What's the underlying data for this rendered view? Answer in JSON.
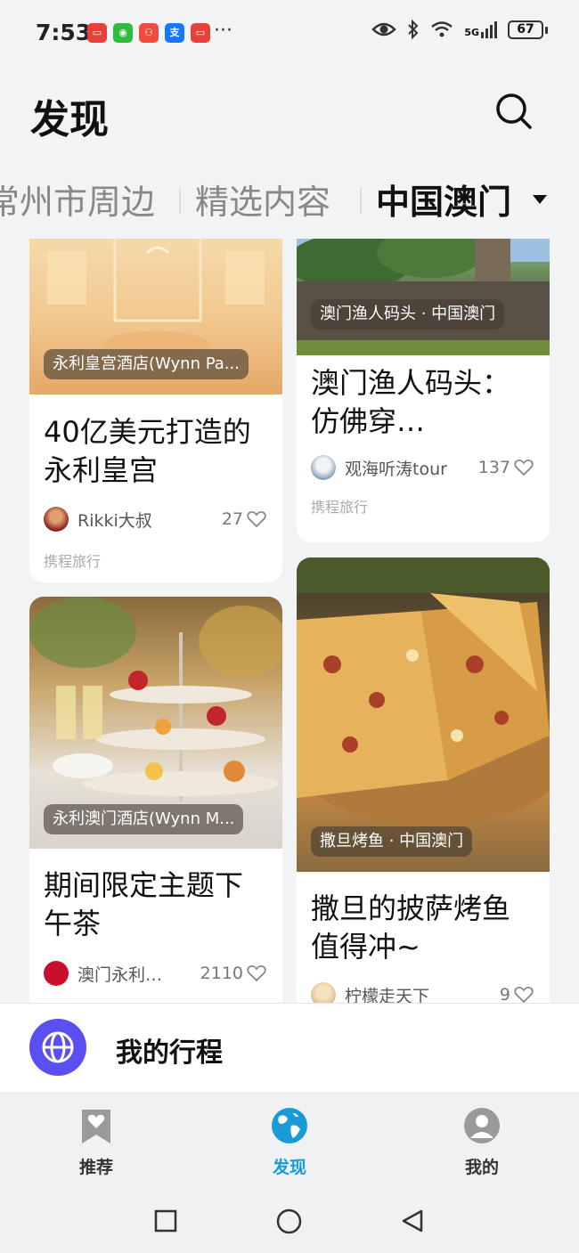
{
  "status_bar": {
    "time": "7:53",
    "app_icons": [
      {
        "name": "app-icon-red-1",
        "color": "#e8413a",
        "glyph": "▭"
      },
      {
        "name": "wechat-icon",
        "color": "#2dbd3a",
        "glyph": "◉"
      },
      {
        "name": "app-icon-red-2",
        "color": "#ef4b3f",
        "glyph": "⚇"
      },
      {
        "name": "alipay-icon",
        "color": "#1677ff",
        "glyph": "支"
      },
      {
        "name": "app-icon-red-3",
        "color": "#e8413a",
        "glyph": "▭"
      }
    ],
    "more": "···",
    "network": "5G",
    "battery": "67"
  },
  "header": {
    "title": "发现"
  },
  "tabs": [
    {
      "label": "常州市周边",
      "active": false
    },
    {
      "label": "精选内容",
      "active": false
    },
    {
      "label": "中国澳门",
      "active": true
    }
  ],
  "cards": [
    {
      "location": "永利皇宫酒店(Wynn Pa...",
      "title": "40亿美元打造的永利皇宫",
      "author": "Rikki大叔",
      "likes": "27",
      "source": "携程旅行"
    },
    {
      "location": "澳门渔人码头 · 中国澳门",
      "title": "澳门渔人码头：仿佛穿…",
      "author": "观海听涛tour",
      "likes": "137",
      "source": "携程旅行"
    },
    {
      "location": "永利澳门酒店(Wynn M...",
      "title": "期间限定主题下午茶",
      "author": "澳门永利…",
      "likes": "2110"
    },
    {
      "location": "撒旦烤鱼 · 中国澳门",
      "title": "撒旦的披萨烤鱼值得冲~",
      "author": "柠檬走天下",
      "likes": "9"
    }
  ],
  "itinerary": {
    "label": "我的行程"
  },
  "bottom_nav": [
    {
      "label": "推荐",
      "icon": "bookmark-heart-icon",
      "active": false
    },
    {
      "label": "发现",
      "icon": "globe-icon",
      "active": true
    },
    {
      "label": "我的",
      "icon": "person-icon",
      "active": false
    }
  ],
  "colors": {
    "accent": "#1a9bd7",
    "itinerary_icon": "#5a4ff0",
    "background": "#f2f3f5"
  }
}
